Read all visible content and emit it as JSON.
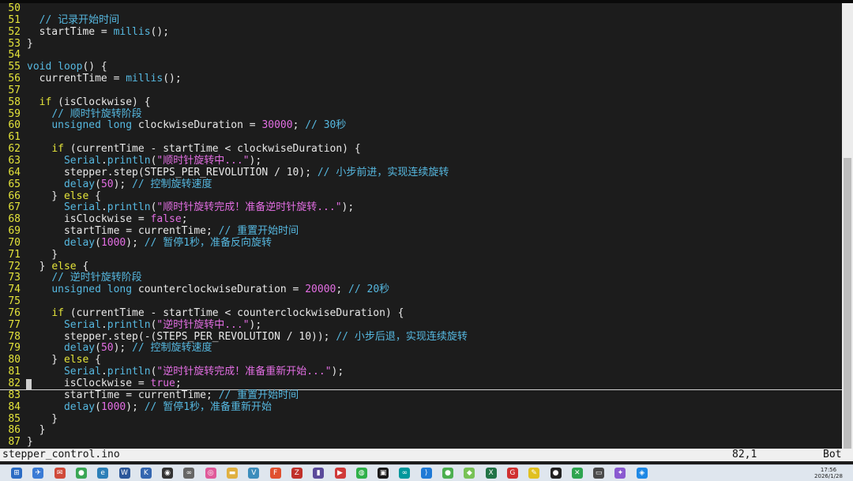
{
  "editor": {
    "lines": [
      {
        "n": "50",
        "tokens": []
      },
      {
        "n": "51",
        "tokens": [
          {
            "t": "  "
          },
          {
            "c": "cm",
            "t": "// 记录开始时间"
          }
        ]
      },
      {
        "n": "52",
        "tokens": [
          {
            "t": "  startTime = "
          },
          {
            "c": "fn",
            "t": "millis"
          },
          {
            "t": "();"
          }
        ]
      },
      {
        "n": "53",
        "tokens": [
          {
            "t": "}"
          }
        ]
      },
      {
        "n": "54",
        "tokens": []
      },
      {
        "n": "55",
        "tokens": [
          {
            "c": "ty",
            "t": "void"
          },
          {
            "t": " "
          },
          {
            "c": "fn",
            "t": "loop"
          },
          {
            "t": "() {"
          }
        ]
      },
      {
        "n": "56",
        "tokens": [
          {
            "t": "  currentTime = "
          },
          {
            "c": "fn",
            "t": "millis"
          },
          {
            "t": "();"
          }
        ]
      },
      {
        "n": "57",
        "tokens": []
      },
      {
        "n": "58",
        "tokens": [
          {
            "t": "  "
          },
          {
            "c": "kw",
            "t": "if"
          },
          {
            "t": " (isClockwise) {"
          }
        ]
      },
      {
        "n": "59",
        "tokens": [
          {
            "t": "    "
          },
          {
            "c": "cm",
            "t": "// 顺时针旋转阶段"
          }
        ]
      },
      {
        "n": "60",
        "tokens": [
          {
            "t": "    "
          },
          {
            "c": "ty",
            "t": "unsigned long"
          },
          {
            "t": " clockwiseDuration = "
          },
          {
            "c": "num",
            "t": "30000"
          },
          {
            "t": "; "
          },
          {
            "c": "cm",
            "t": "// 30秒"
          }
        ]
      },
      {
        "n": "61",
        "tokens": []
      },
      {
        "n": "62",
        "tokens": [
          {
            "t": "    "
          },
          {
            "c": "kw",
            "t": "if"
          },
          {
            "t": " (currentTime - startTime < clockwiseDuration) {"
          }
        ]
      },
      {
        "n": "63",
        "tokens": [
          {
            "t": "      "
          },
          {
            "c": "fn",
            "t": "Serial"
          },
          {
            "t": "."
          },
          {
            "c": "fn",
            "t": "println"
          },
          {
            "t": "("
          },
          {
            "c": "str",
            "t": "\"顺时针旋转中...\""
          },
          {
            "t": ");"
          }
        ]
      },
      {
        "n": "64",
        "tokens": [
          {
            "t": "      stepper.step(STEPS_PER_REVOLUTION / 10); "
          },
          {
            "c": "cm",
            "t": "// 小步前进，实现连续旋转"
          }
        ]
      },
      {
        "n": "65",
        "tokens": [
          {
            "t": "      "
          },
          {
            "c": "fn",
            "t": "delay"
          },
          {
            "t": "("
          },
          {
            "c": "num",
            "t": "50"
          },
          {
            "t": "); "
          },
          {
            "c": "cm",
            "t": "// 控制旋转速度"
          }
        ]
      },
      {
        "n": "66",
        "tokens": [
          {
            "t": "    } "
          },
          {
            "c": "kw",
            "t": "else"
          },
          {
            "t": " {"
          }
        ]
      },
      {
        "n": "67",
        "tokens": [
          {
            "t": "      "
          },
          {
            "c": "fn",
            "t": "Serial"
          },
          {
            "t": "."
          },
          {
            "c": "fn",
            "t": "println"
          },
          {
            "t": "("
          },
          {
            "c": "str",
            "t": "\"顺时针旋转完成！准备逆时针旋转...\""
          },
          {
            "t": ");"
          }
        ]
      },
      {
        "n": "68",
        "tokens": [
          {
            "t": "      isClockwise = "
          },
          {
            "c": "num",
            "t": "false"
          },
          {
            "t": ";"
          }
        ]
      },
      {
        "n": "69",
        "tokens": [
          {
            "t": "      startTime = currentTime; "
          },
          {
            "c": "cm",
            "t": "// 重置开始时间"
          }
        ]
      },
      {
        "n": "70",
        "tokens": [
          {
            "t": "      "
          },
          {
            "c": "fn",
            "t": "delay"
          },
          {
            "t": "("
          },
          {
            "c": "num",
            "t": "1000"
          },
          {
            "t": "); "
          },
          {
            "c": "cm",
            "t": "// 暂停1秒，准备反向旋转"
          }
        ]
      },
      {
        "n": "71",
        "tokens": [
          {
            "t": "    }"
          }
        ]
      },
      {
        "n": "72",
        "tokens": [
          {
            "t": "  } "
          },
          {
            "c": "kw",
            "t": "else"
          },
          {
            "t": " {"
          }
        ]
      },
      {
        "n": "73",
        "tokens": [
          {
            "t": "    "
          },
          {
            "c": "cm",
            "t": "// 逆时针旋转阶段"
          }
        ]
      },
      {
        "n": "74",
        "tokens": [
          {
            "t": "    "
          },
          {
            "c": "ty",
            "t": "unsigned long"
          },
          {
            "t": " counterclockwiseDuration = "
          },
          {
            "c": "num",
            "t": "20000"
          },
          {
            "t": "; "
          },
          {
            "c": "cm",
            "t": "// 20秒"
          }
        ]
      },
      {
        "n": "75",
        "tokens": []
      },
      {
        "n": "76",
        "tokens": [
          {
            "t": "    "
          },
          {
            "c": "kw",
            "t": "if"
          },
          {
            "t": " (currentTime - startTime < counterclockwiseDuration) {"
          }
        ]
      },
      {
        "n": "77",
        "tokens": [
          {
            "t": "      "
          },
          {
            "c": "fn",
            "t": "Serial"
          },
          {
            "t": "."
          },
          {
            "c": "fn",
            "t": "println"
          },
          {
            "t": "("
          },
          {
            "c": "str",
            "t": "\"逆时针旋转中...\""
          },
          {
            "t": ");"
          }
        ]
      },
      {
        "n": "78",
        "tokens": [
          {
            "t": "      stepper.step(-(STEPS_PER_REVOLUTION / 10)); "
          },
          {
            "c": "cm",
            "t": "// 小步后退，实现连续旋转"
          }
        ]
      },
      {
        "n": "79",
        "tokens": [
          {
            "t": "      "
          },
          {
            "c": "fn",
            "t": "delay"
          },
          {
            "t": "("
          },
          {
            "c": "num",
            "t": "50"
          },
          {
            "t": "); "
          },
          {
            "c": "cm",
            "t": "// 控制旋转速度"
          }
        ]
      },
      {
        "n": "80",
        "tokens": [
          {
            "t": "    } "
          },
          {
            "c": "kw",
            "t": "else"
          },
          {
            "t": " {"
          }
        ]
      },
      {
        "n": "81",
        "tokens": [
          {
            "t": "      "
          },
          {
            "c": "fn",
            "t": "Serial"
          },
          {
            "t": "."
          },
          {
            "c": "fn",
            "t": "println"
          },
          {
            "t": "("
          },
          {
            "c": "str",
            "t": "\"逆时针旋转完成！准备重新开始...\""
          },
          {
            "t": ");"
          }
        ]
      },
      {
        "n": "82",
        "tokens": [
          {
            "t": "      isClockwise = "
          },
          {
            "c": "num",
            "t": "true"
          },
          {
            "t": ";"
          }
        ],
        "cursor": true
      },
      {
        "n": "83",
        "tokens": [
          {
            "t": "      startTime = currentTime; "
          },
          {
            "c": "cm",
            "t": "// 重置开始时间"
          }
        ]
      },
      {
        "n": "84",
        "tokens": [
          {
            "t": "      "
          },
          {
            "c": "fn",
            "t": "delay"
          },
          {
            "t": "("
          },
          {
            "c": "num",
            "t": "1000"
          },
          {
            "t": "); "
          },
          {
            "c": "cm",
            "t": "// 暂停1秒，准备重新开始"
          }
        ]
      },
      {
        "n": "85",
        "tokens": [
          {
            "t": "    }"
          }
        ]
      },
      {
        "n": "86",
        "tokens": [
          {
            "t": "  }"
          }
        ]
      },
      {
        "n": "87",
        "tokens": [
          {
            "t": "}"
          }
        ]
      }
    ]
  },
  "status": {
    "filename": "stepper_control.ino",
    "position": "82,1",
    "scroll": "Bot"
  },
  "taskbar": {
    "icons": [
      {
        "name": "start-icon",
        "color": "#2b6cc4",
        "glyph": "⊞"
      },
      {
        "name": "arrow-app-icon",
        "color": "#3a7bd5",
        "glyph": "✈"
      },
      {
        "name": "mail-app-icon",
        "color": "#d04a3a",
        "glyph": "✉"
      },
      {
        "name": "chrome-icon",
        "color": "#3aa655",
        "glyph": "●"
      },
      {
        "name": "edge-icon",
        "color": "#2c7fb8",
        "glyph": "e"
      },
      {
        "name": "word-icon",
        "color": "#2b579a",
        "glyph": "W"
      },
      {
        "name": "ki-app-icon",
        "color": "#3466b0",
        "glyph": "K"
      },
      {
        "name": "panda-icon",
        "color": "#333333",
        "glyph": "◉"
      },
      {
        "name": "glasses-icon",
        "color": "#666666",
        "glyph": "∞"
      },
      {
        "name": "pig-icon",
        "color": "#e05a9a",
        "glyph": "◎"
      },
      {
        "name": "folder-icon",
        "color": "#e0b040",
        "glyph": "▬"
      },
      {
        "name": "vb-icon",
        "color": "#3c8dbc",
        "glyph": "V"
      },
      {
        "name": "f-app-icon",
        "color": "#e05030",
        "glyph": "F"
      },
      {
        "name": "filezilla-icon",
        "color": "#c0302a",
        "glyph": "Z"
      },
      {
        "name": "doc-app-icon",
        "color": "#5a4a9a",
        "glyph": "▮"
      },
      {
        "name": "flag-icon",
        "color": "#d03a3a",
        "glyph": "▶"
      },
      {
        "name": "chat-icon",
        "color": "#2fb04a",
        "glyph": "◍"
      },
      {
        "name": "terminal-icon",
        "color": "#1a1a1a",
        "glyph": "▣"
      },
      {
        "name": "arduino-icon",
        "color": "#00979c",
        "glyph": "∞"
      },
      {
        "name": "vscode-icon",
        "color": "#1f7ad6",
        "glyph": "⟩"
      },
      {
        "name": "green-app-icon",
        "color": "#4caf50",
        "glyph": "●"
      },
      {
        "name": "android-icon",
        "color": "#78c257",
        "glyph": "◆"
      },
      {
        "name": "excel-icon",
        "color": "#217346",
        "glyph": "X"
      },
      {
        "name": "g-app-icon",
        "color": "#d03030",
        "glyph": "G"
      },
      {
        "name": "pencil-icon",
        "color": "#e0c020",
        "glyph": "✎"
      },
      {
        "name": "github-icon",
        "color": "#222222",
        "glyph": "●"
      },
      {
        "name": "x-app-icon",
        "color": "#2ea44f",
        "glyph": "✕"
      },
      {
        "name": "monitor-icon",
        "color": "#4a4a4a",
        "glyph": "▭"
      },
      {
        "name": "ai-app-icon",
        "color": "#8a5ad0",
        "glyph": "✦"
      },
      {
        "name": "active-app-icon",
        "color": "#1e88e5",
        "glyph": "◈"
      }
    ],
    "time": "17:56",
    "date": "2026/1/28"
  }
}
